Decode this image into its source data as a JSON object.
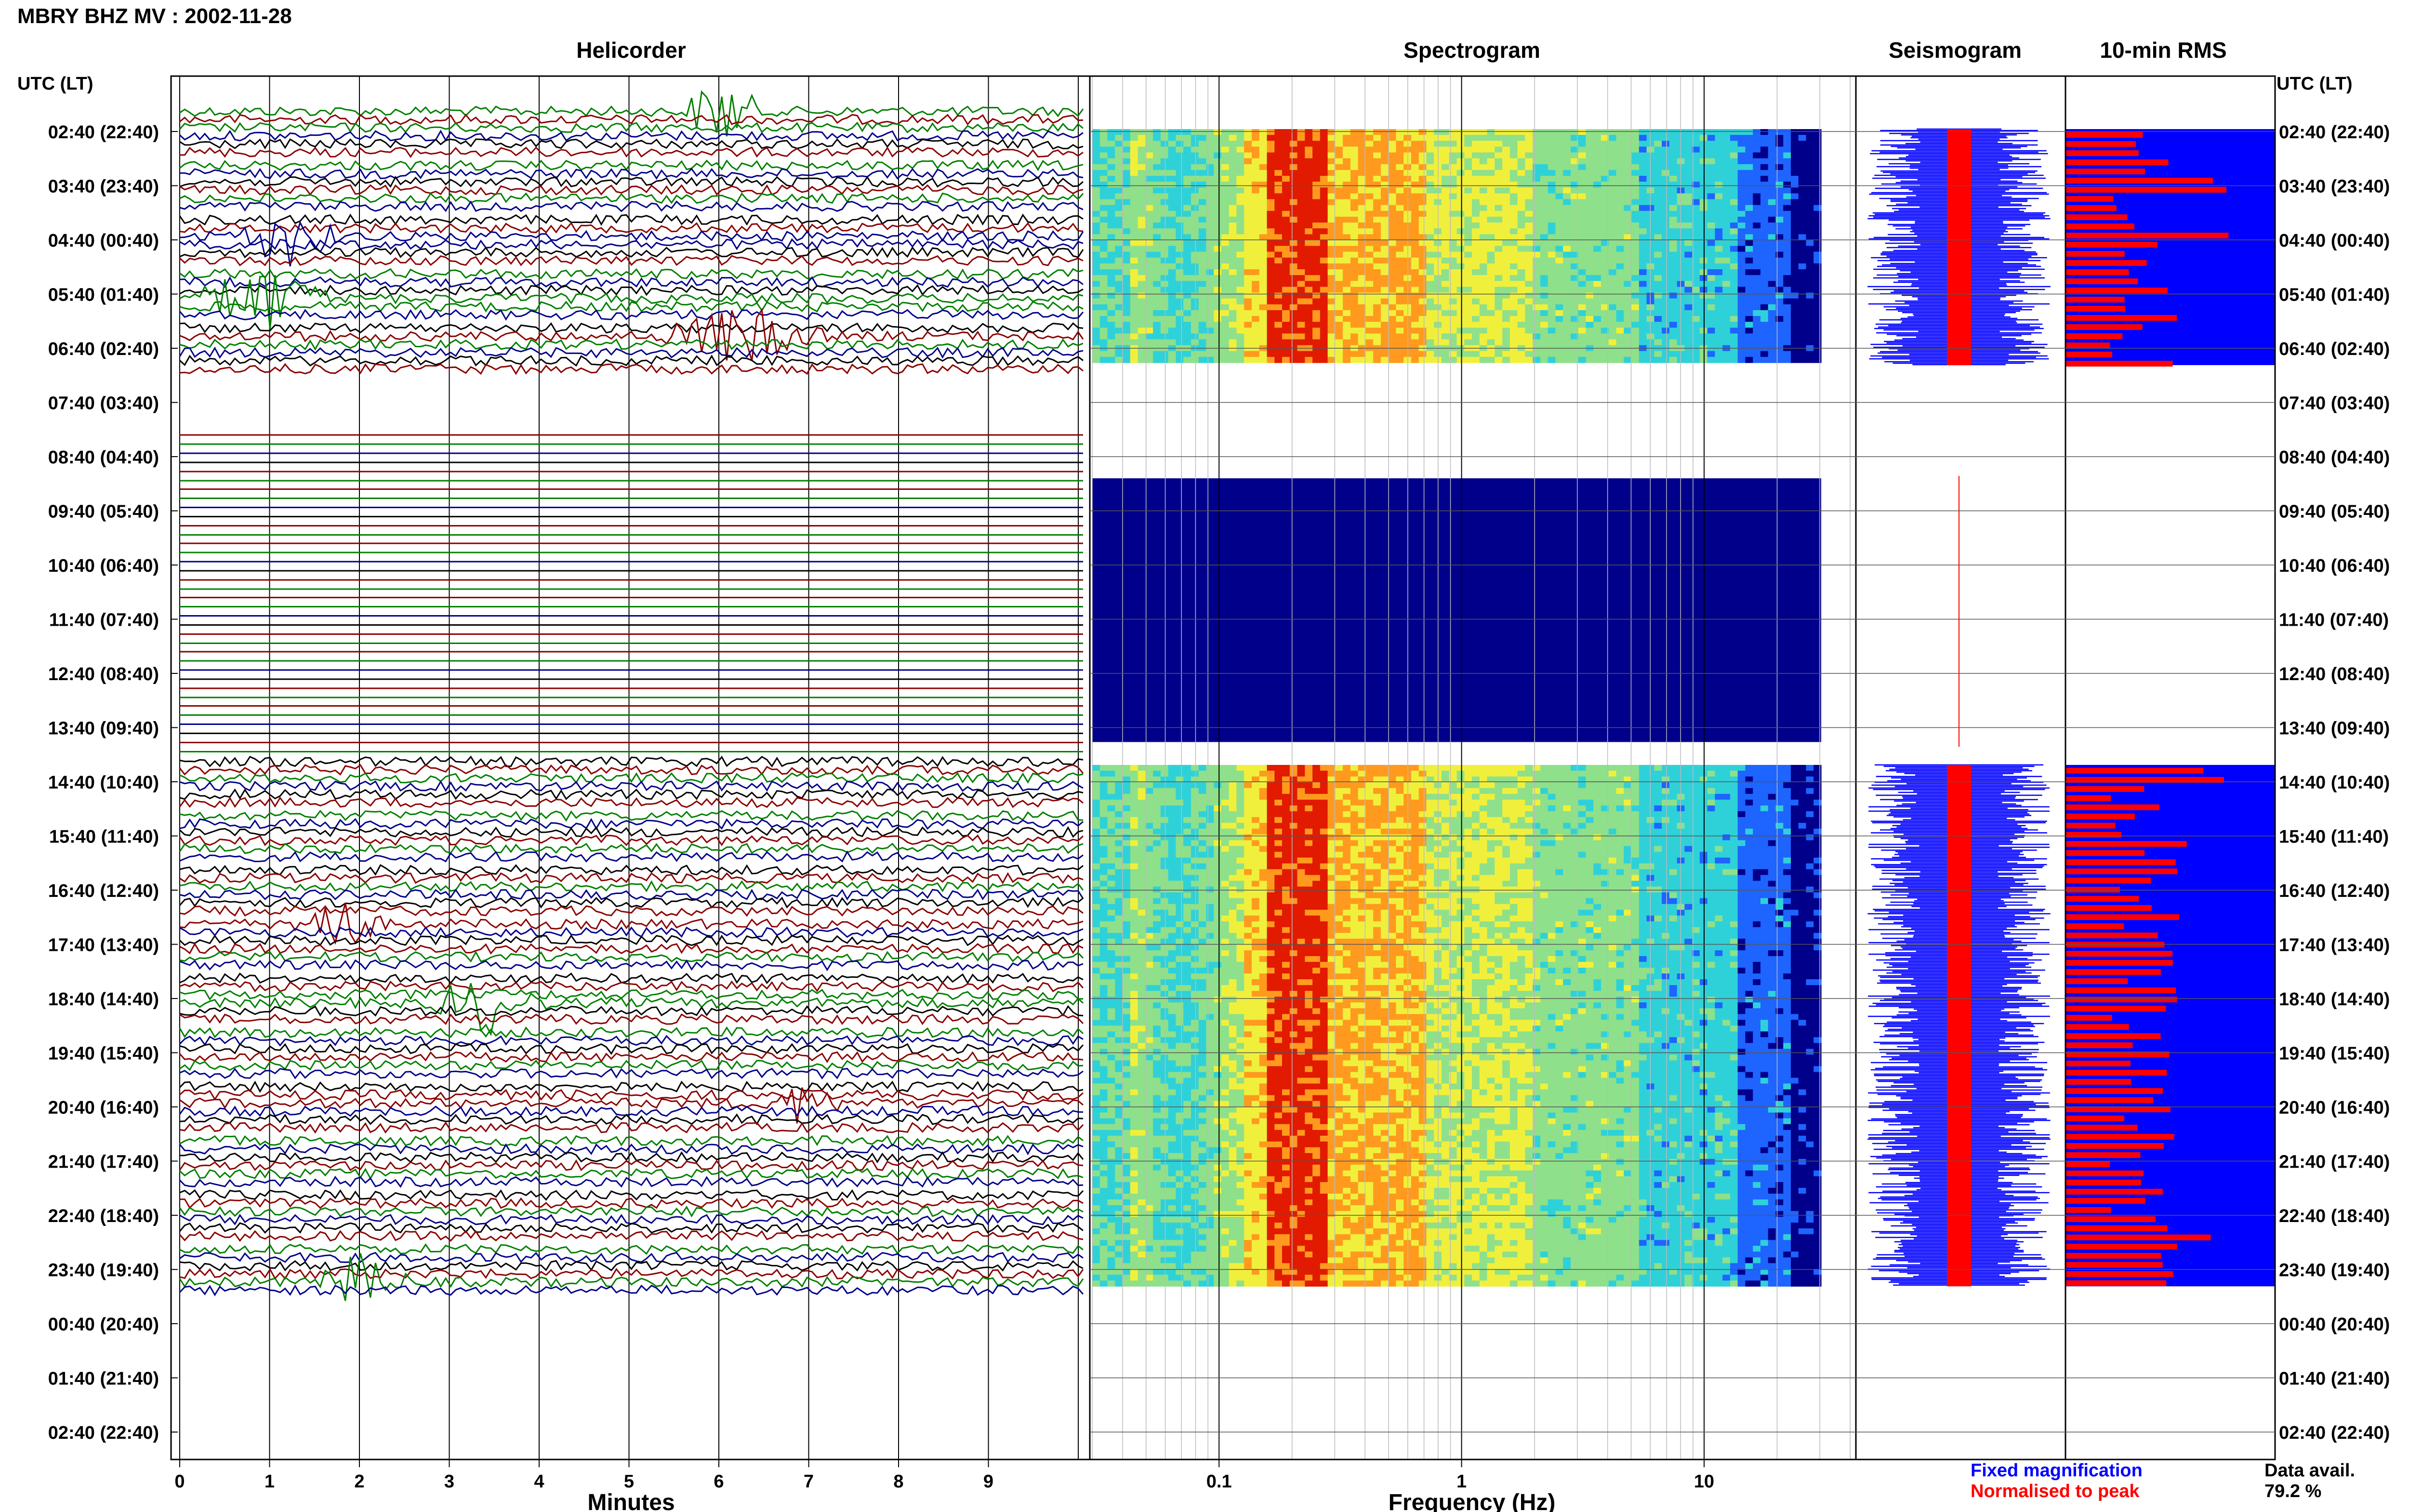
{
  "header": {
    "title": "MBRY BHZ MV : 2002-11-28"
  },
  "panels": {
    "helicorder": "Helicorder",
    "spectrogram": "Spectrogram",
    "seismogram": "Seismogram",
    "rms": "10-min RMS"
  },
  "axis_left_title": "UTC (LT)",
  "axis_right_title": "UTC (LT)",
  "time_labels": [
    "02:40 (22:40)",
    "03:40 (23:40)",
    "04:40 (00:40)",
    "05:40 (01:40)",
    "06:40 (02:40)",
    "07:40 (03:40)",
    "08:40 (04:40)",
    "09:40 (05:40)",
    "10:40 (06:40)",
    "11:40 (07:40)",
    "12:40 (08:40)",
    "13:40 (09:40)",
    "14:40 (10:40)",
    "15:40 (11:40)",
    "16:40 (12:40)",
    "17:40 (13:40)",
    "18:40 (14:40)",
    "19:40 (15:40)",
    "20:40 (16:40)",
    "21:40 (17:40)",
    "22:40 (18:40)",
    "23:40 (19:40)",
    "00:40 (20:40)",
    "01:40 (21:40)",
    "02:40 (22:40)"
  ],
  "x_helicorder": {
    "label": "Minutes",
    "ticks": [
      "0",
      "1",
      "2",
      "3",
      "4",
      "5",
      "6",
      "7",
      "8",
      "9"
    ]
  },
  "x_spectrogram": {
    "label": "Frequency (Hz)",
    "ticks": [
      "0.1",
      "1",
      "10"
    ]
  },
  "legend": {
    "fixed": "Fixed magnification",
    "normalised": "Normalised to peak",
    "fixed_color": "#0000ff",
    "normalised_color": "#ff0000"
  },
  "data_avail": {
    "label": "Data avail.",
    "value": "79.2 %"
  },
  "colors": {
    "trace": [
      "#000000",
      "#8b0000",
      "#008000",
      "#00008b"
    ],
    "spec_bg": "#00008b",
    "seis_fixed": "#0000ff",
    "seis_norm": "#ff0000"
  },
  "chart_data": {
    "type": "heatmap",
    "title": "MBRY BHZ MV : 2002-11-28",
    "helicorder": {
      "x": "Minutes",
      "xlim": [
        0,
        10
      ],
      "hours_with_data_utc": [
        "02:40",
        "03:40",
        "04:40",
        "05:40",
        "06:40",
        "14:40",
        "15:40",
        "16:40",
        "17:40",
        "18:40",
        "19:40",
        "20:40",
        "21:40",
        "22:40",
        "23:40"
      ],
      "flatline_hours_utc": [
        "08:40",
        "09:40",
        "10:40",
        "11:40",
        "12:40",
        "13:40"
      ]
    },
    "spectrogram": {
      "xscale": "log",
      "xlim": [
        0.03,
        40
      ],
      "peak_band_hz": [
        0.15,
        0.35
      ],
      "data_segments_utc": [
        [
          "02:40",
          "06:40"
        ],
        [
          "14:40",
          "23:40"
        ]
      ],
      "no_signal_segment_utc": [
        "08:40",
        "13:40"
      ]
    },
    "data_availability_percent": 79.2
  }
}
